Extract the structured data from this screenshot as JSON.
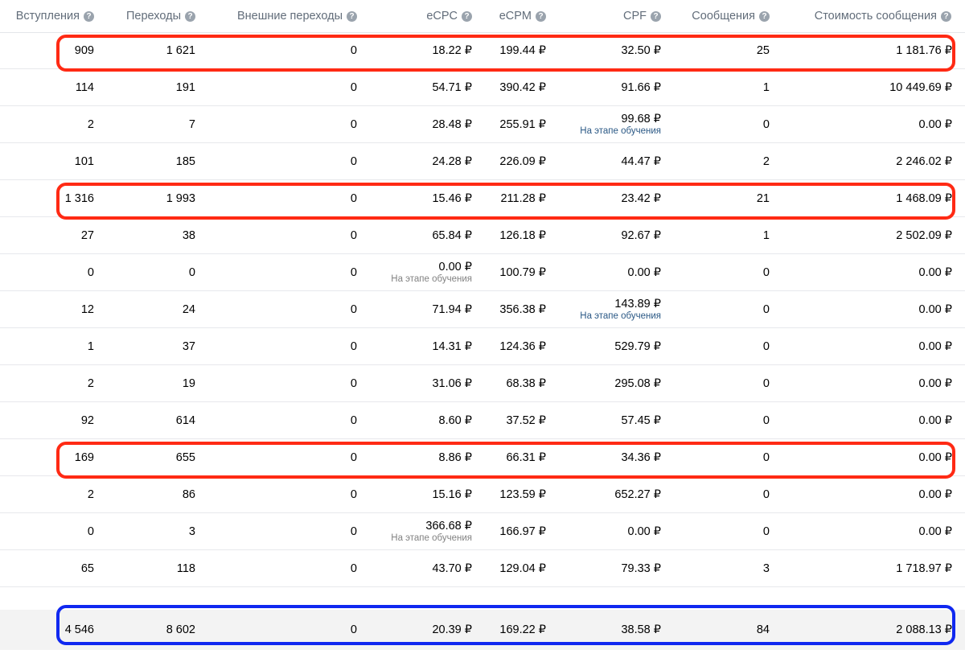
{
  "columns": [
    {
      "label": "Вступления"
    },
    {
      "label": "Переходы"
    },
    {
      "label": "Внешние переходы"
    },
    {
      "label": "eCPC"
    },
    {
      "label": "eCPM"
    },
    {
      "label": "CPF"
    },
    {
      "label": "Сообщения"
    },
    {
      "label": "Стоимость сообщения"
    }
  ],
  "rows": [
    {
      "cells": [
        {
          "v": "909"
        },
        {
          "v": "1 621"
        },
        {
          "v": "0"
        },
        {
          "v": "18.22 ₽"
        },
        {
          "v": "199.44 ₽"
        },
        {
          "v": "32.50 ₽"
        },
        {
          "v": "25"
        },
        {
          "v": "1 181.76 ₽"
        }
      ],
      "highlight": "red"
    },
    {
      "cells": [
        {
          "v": "114"
        },
        {
          "v": "191"
        },
        {
          "v": "0"
        },
        {
          "v": "54.71 ₽"
        },
        {
          "v": "390.42 ₽"
        },
        {
          "v": "91.66 ₽"
        },
        {
          "v": "1"
        },
        {
          "v": "10 449.69 ₽"
        }
      ]
    },
    {
      "cells": [
        {
          "v": "2"
        },
        {
          "v": "7"
        },
        {
          "v": "0"
        },
        {
          "v": "28.48 ₽"
        },
        {
          "v": "255.91 ₽"
        },
        {
          "v": "99.68 ₽",
          "sub": "На этапе обучения",
          "subcolor": "blue"
        },
        {
          "v": "0"
        },
        {
          "v": "0.00 ₽"
        }
      ]
    },
    {
      "cells": [
        {
          "v": "101"
        },
        {
          "v": "185"
        },
        {
          "v": "0"
        },
        {
          "v": "24.28 ₽"
        },
        {
          "v": "226.09 ₽"
        },
        {
          "v": "44.47 ₽"
        },
        {
          "v": "2"
        },
        {
          "v": "2 246.02 ₽"
        }
      ]
    },
    {
      "cells": [
        {
          "v": "1 316"
        },
        {
          "v": "1 993"
        },
        {
          "v": "0"
        },
        {
          "v": "15.46 ₽"
        },
        {
          "v": "211.28 ₽"
        },
        {
          "v": "23.42 ₽"
        },
        {
          "v": "21"
        },
        {
          "v": "1 468.09 ₽"
        }
      ],
      "highlight": "red"
    },
    {
      "cells": [
        {
          "v": "27"
        },
        {
          "v": "38"
        },
        {
          "v": "0"
        },
        {
          "v": "65.84 ₽"
        },
        {
          "v": "126.18 ₽"
        },
        {
          "v": "92.67 ₽"
        },
        {
          "v": "1"
        },
        {
          "v": "2 502.09 ₽"
        }
      ]
    },
    {
      "cells": [
        {
          "v": "0"
        },
        {
          "v": "0"
        },
        {
          "v": "0"
        },
        {
          "v": "0.00 ₽",
          "sub": "На этапе обучения",
          "subcolor": "gray"
        },
        {
          "v": "100.79 ₽"
        },
        {
          "v": "0.00 ₽"
        },
        {
          "v": "0"
        },
        {
          "v": "0.00 ₽"
        }
      ]
    },
    {
      "cells": [
        {
          "v": "12"
        },
        {
          "v": "24"
        },
        {
          "v": "0"
        },
        {
          "v": "71.94 ₽"
        },
        {
          "v": "356.38 ₽"
        },
        {
          "v": "143.89 ₽",
          "sub": "На этапе обучения",
          "subcolor": "blue"
        },
        {
          "v": "0"
        },
        {
          "v": "0.00 ₽"
        }
      ]
    },
    {
      "cells": [
        {
          "v": "1"
        },
        {
          "v": "37"
        },
        {
          "v": "0"
        },
        {
          "v": "14.31 ₽"
        },
        {
          "v": "124.36 ₽"
        },
        {
          "v": "529.79 ₽"
        },
        {
          "v": "0"
        },
        {
          "v": "0.00 ₽"
        }
      ]
    },
    {
      "cells": [
        {
          "v": "2"
        },
        {
          "v": "19"
        },
        {
          "v": "0"
        },
        {
          "v": "31.06 ₽"
        },
        {
          "v": "68.38 ₽"
        },
        {
          "v": "295.08 ₽"
        },
        {
          "v": "0"
        },
        {
          "v": "0.00 ₽"
        }
      ]
    },
    {
      "cells": [
        {
          "v": "92"
        },
        {
          "v": "614"
        },
        {
          "v": "0"
        },
        {
          "v": "8.60 ₽"
        },
        {
          "v": "37.52 ₽"
        },
        {
          "v": "57.45 ₽"
        },
        {
          "v": "0"
        },
        {
          "v": "0.00 ₽"
        }
      ]
    },
    {
      "cells": [
        {
          "v": "169"
        },
        {
          "v": "655"
        },
        {
          "v": "0"
        },
        {
          "v": "8.86 ₽"
        },
        {
          "v": "66.31 ₽"
        },
        {
          "v": "34.36 ₽"
        },
        {
          "v": "0"
        },
        {
          "v": "0.00 ₽"
        }
      ],
      "highlight": "red"
    },
    {
      "cells": [
        {
          "v": "2"
        },
        {
          "v": "86"
        },
        {
          "v": "0"
        },
        {
          "v": "15.16 ₽"
        },
        {
          "v": "123.59 ₽"
        },
        {
          "v": "652.27 ₽"
        },
        {
          "v": "0"
        },
        {
          "v": "0.00 ₽"
        }
      ]
    },
    {
      "cells": [
        {
          "v": "0"
        },
        {
          "v": "3"
        },
        {
          "v": "0"
        },
        {
          "v": "366.68 ₽",
          "sub": "На этапе обучения",
          "subcolor": "gray"
        },
        {
          "v": "166.97 ₽"
        },
        {
          "v": "0.00 ₽"
        },
        {
          "v": "0"
        },
        {
          "v": "0.00 ₽"
        }
      ]
    },
    {
      "cells": [
        {
          "v": "65"
        },
        {
          "v": "118"
        },
        {
          "v": "0"
        },
        {
          "v": "43.70 ₽"
        },
        {
          "v": "129.04 ₽"
        },
        {
          "v": "79.33 ₽"
        },
        {
          "v": "3"
        },
        {
          "v": "1 718.97 ₽"
        }
      ]
    }
  ],
  "total": {
    "cells": [
      {
        "v": "4 546"
      },
      {
        "v": "8 602"
      },
      {
        "v": "0"
      },
      {
        "v": "20.39 ₽"
      },
      {
        "v": "169.22 ₽"
      },
      {
        "v": "38.58 ₽"
      },
      {
        "v": "84"
      },
      {
        "v": "2 088.13 ₽"
      }
    ],
    "highlight": "blue"
  },
  "colors": {
    "highlight_red": "#ff2a14",
    "highlight_blue": "#1028f0",
    "training_blue": "#2a5885",
    "training_gray": "#828282",
    "header_text": "#626d7a"
  },
  "icons": {
    "column_help": "question-circle-icon"
  }
}
